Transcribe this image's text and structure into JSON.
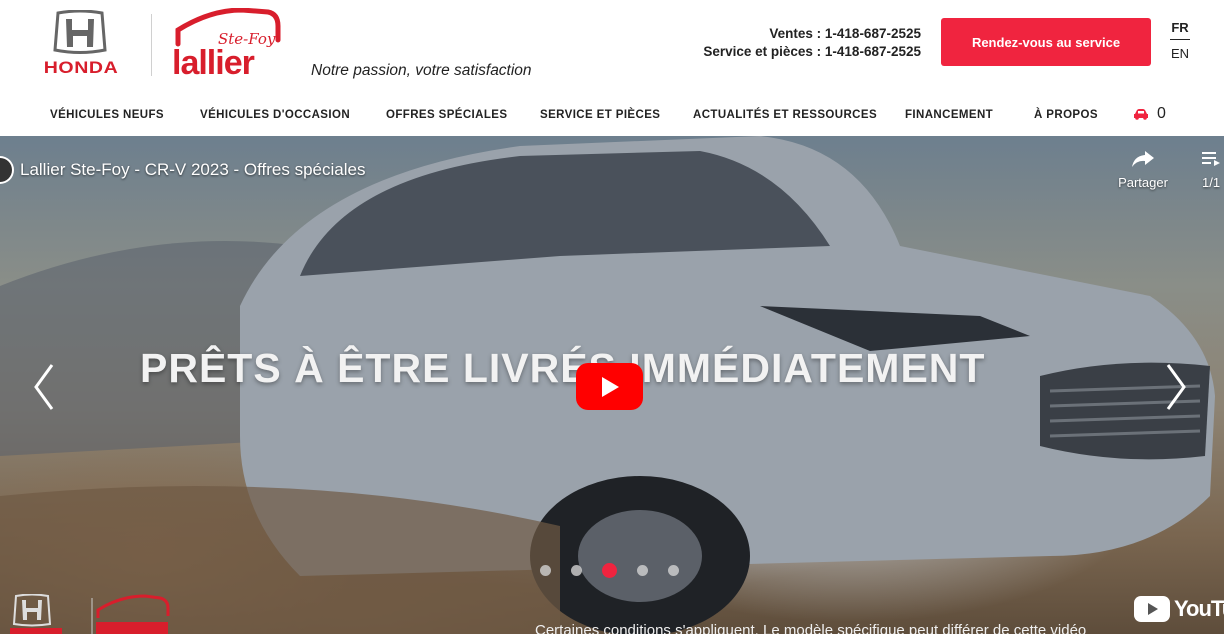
{
  "header": {
    "brand": "HONDA",
    "dealer_name": "lallier",
    "dealer_location": "Ste-Foy",
    "tagline": "Notre passion, votre satisfaction",
    "phone_sales": "Ventes : 1-418-687-2525",
    "phone_service": "Service et pièces : 1-418-687-2525",
    "cta_button": "Rendez-vous au service",
    "lang_fr": "FR",
    "lang_en": "EN"
  },
  "nav": {
    "items": [
      {
        "label": "VÉHICULES NEUFS"
      },
      {
        "label": "VÉHICULES D'OCCASION"
      },
      {
        "label": "OFFRES SPÉCIALES"
      },
      {
        "label": "SERVICE ET PIÈCES"
      },
      {
        "label": "ACTUALITÉS ET RESSOURCES"
      },
      {
        "label": "FINANCEMENT"
      },
      {
        "label": "À PROPOS"
      }
    ],
    "cart_count": "0",
    "cart_icon": "car-icon"
  },
  "hero": {
    "video_title": "Lallier Ste-Foy - CR-V 2023 - Offres spéciales",
    "share_label": "Partager",
    "playlist_count": "1/1",
    "headline": "PRÊTS À ÊTRE LIVRÉS IMMÉDIATEMENT",
    "youtube_label": "YouTube",
    "disclaimer": "Certaines conditions s'appliquent. Le modèle spécifique peut différer de cette vidéo",
    "slides_total": 5,
    "active_slide": 3
  },
  "colors": {
    "accent": "#f0243f",
    "honda_red": "#d81e2c",
    "youtube_red": "#ff0000"
  }
}
